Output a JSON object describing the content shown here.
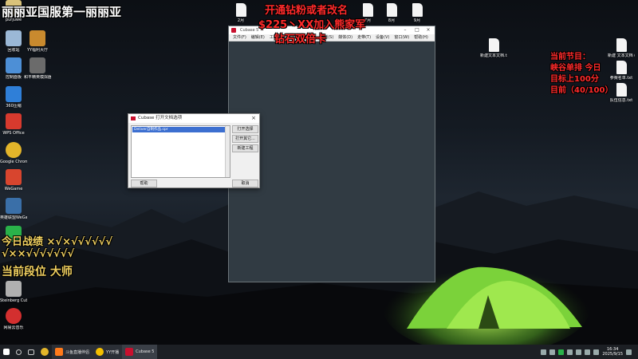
{
  "overlays": {
    "top_left": "丽丽亚国服第一丽丽亚",
    "promo_line1": "开通钻粉或者改名",
    "promo_line2": "$225丶XX加入熊家军",
    "promo_line3": "钻石双倍卡",
    "right_line1": "当前节目：",
    "right_line2": "峡谷单排 今日",
    "right_line3": "目标上100分",
    "right_line4": "目前（40/100）",
    "record_line1": "今日战绩 ×√×√√√√√√",
    "record_line2": "√××√√√√√√√",
    "rank_line": "当前段位 大师"
  },
  "desktop_left": [
    {
      "label": "purjuwe",
      "color": "#d9c27a",
      "icon": "folder-icon"
    },
    {
      "label": "YY福利大厅",
      "color": "#c98a2e",
      "icon": "app-icon"
    },
    {
      "label": "回收站",
      "color": "#9bb8d6",
      "icon": "recycle-bin-icon"
    },
    {
      "label": "控制面板",
      "color": "#4d8fd6",
      "icon": "control-panel-icon"
    },
    {
      "label": "和平精英模拟器WeGam...",
      "color": "#6b6b6b",
      "icon": "game-icon"
    },
    {
      "label": "360压缩",
      "color": "#2f7fd8",
      "icon": "archive-icon"
    },
    {
      "label": "WPS Office",
      "color": "#d73a2e",
      "icon": "wps-icon"
    },
    {
      "label": "Google Chrome",
      "color": "#e3b52a",
      "icon": "chrome-icon"
    },
    {
      "label": "WeGame",
      "color": "#d8452e",
      "icon": "wegame-icon"
    },
    {
      "label": "英雄联盟WeGame版",
      "color": "#3a6fa8",
      "icon": "lol-icon"
    },
    {
      "label": "微信",
      "color": "#2ab24a",
      "icon": "wechat-icon"
    },
    {
      "label": "Steinberg Cubase 5",
      "color": "#b0b0b0",
      "icon": "cubase-icon"
    },
    {
      "label": "网易云音乐",
      "color": "#d32f2f",
      "icon": "music-icon"
    }
  ],
  "desktop_top": [
    {
      "label": "2月"
    },
    {
      "label": "7月"
    },
    {
      "label": "8月"
    },
    {
      "label": "9月"
    }
  ],
  "desktop_right": [
    {
      "label": "新建文本文档.txt"
    },
    {
      "label": "新建 文本文档 (3).txt"
    },
    {
      "label": "参赛名单.txt"
    },
    {
      "label": "队伍信息.txt"
    }
  ],
  "cubase": {
    "title": "Cubase 5",
    "menu": [
      "文件(F)",
      "编辑(E)",
      "工程(P)",
      "音频(A)",
      "MIDI",
      "乐谱(S)",
      "媒体(D)",
      "走带(T)",
      "设备(V)",
      "窗口(W)",
      "帮助(H)"
    ]
  },
  "dialog": {
    "title": "Cubase 打开文档选项",
    "list_item": "Deliver自制作品.cpr",
    "btn_open_selected": "打开选择",
    "btn_open_other": "打开其它...",
    "btn_new_project": "新建工程",
    "btn_help": "帮助",
    "btn_cancel": "取消"
  },
  "taskbar": {
    "app1": "斗鱼直播伴侣",
    "app2": "YY开播",
    "app3": "Cubase 5",
    "time": "16:34",
    "date": "2025/9/15"
  },
  "colors": {
    "overlay_white": "#ffffff",
    "overlay_red": "#ff2a2a",
    "overlay_yellow": "#ffe25a",
    "overlay_gold": "#f0d060",
    "cubase_bg": "#313b43",
    "tent_green": "#7bd23a"
  }
}
